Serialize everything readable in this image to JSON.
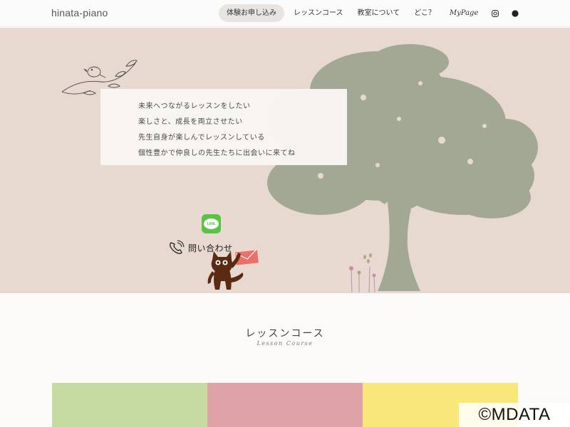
{
  "header": {
    "logo": "hinata-piano",
    "nav": [
      {
        "label": "体験お申し込み"
      },
      {
        "label": "レッスンコース"
      },
      {
        "label": "教室について"
      },
      {
        "label": "どこ？"
      },
      {
        "label": "MyPage"
      }
    ],
    "icons": [
      "instagram-icon",
      "account-icon"
    ]
  },
  "hero": {
    "message_lines": [
      "未来へつながるレッスンをしたい",
      "楽しさと、成長を両立させたい",
      "先生自身が楽しんでレッスンしている",
      "個性豊かで仲良しの先生たちに出会いに来てね"
    ],
    "line_badge": "LINE",
    "contact_label": "問い合わせ"
  },
  "lesson": {
    "title": "レッスンコース",
    "subtitle": "Lesson Course"
  },
  "colors": {
    "hero_bg": "#e7d9cf",
    "tree": "#a3a895",
    "card_green": "#c5dba1",
    "card_pink": "#dfa2a7",
    "card_yellow": "#fae77c",
    "line_green": "#5ac346",
    "envelope": "#ec6f6a",
    "cat": "#5a2a12"
  },
  "watermark": "©MDATA"
}
